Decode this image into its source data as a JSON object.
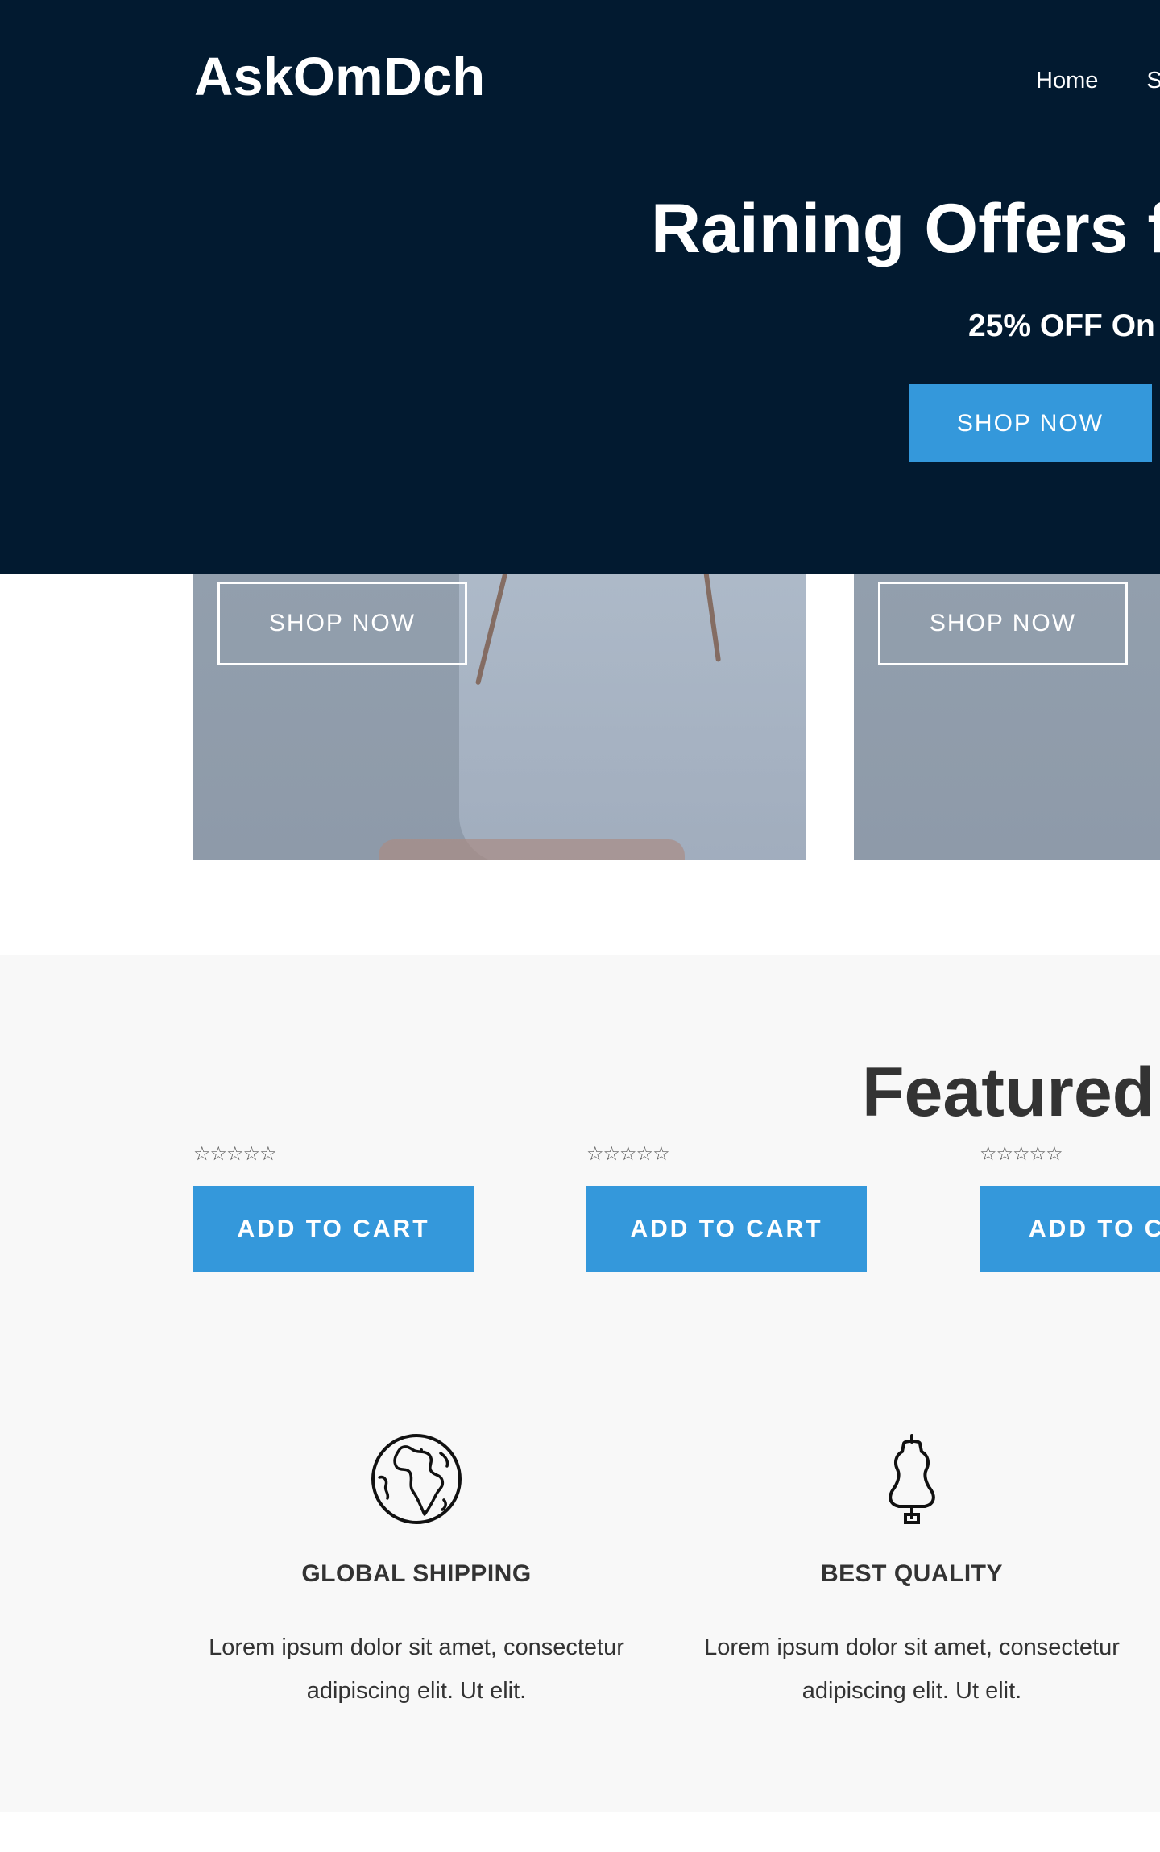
{
  "header": {
    "logo": "AskOmDch",
    "nav": [
      "Home",
      "S"
    ]
  },
  "hero": {
    "title": "Raining Offers f",
    "subtitle": "25% OFF On",
    "button": "SHOP NOW"
  },
  "categories": [
    {
      "button": "SHOP NOW"
    },
    {
      "button": "SHOP NOW"
    }
  ],
  "featured": {
    "title": "Featured",
    "products": [
      {
        "rating": "☆☆☆☆☆",
        "button": "ADD TO CART"
      },
      {
        "rating": "☆☆☆☆☆",
        "button": "ADD TO CART"
      },
      {
        "rating": "☆☆☆☆☆",
        "button": "ADD TO CA"
      }
    ]
  },
  "features": [
    {
      "icon": "globe-icon",
      "title": "GLOBAL SHIPPING",
      "text_line1": "Lorem ipsum dolor sit amet, consectetur",
      "text_line2": "adipiscing elit. Ut elit."
    },
    {
      "icon": "dress-form-icon",
      "title": "BEST QUALITY",
      "text_line1": "Lorem ipsum dolor sit amet, consectetur",
      "text_line2": "adipiscing elit. Ut elit."
    }
  ],
  "colors": {
    "hero_bg": "#021a30",
    "accent": "#3498db",
    "section_bg": "#f8f8f8",
    "heading": "#333333"
  }
}
